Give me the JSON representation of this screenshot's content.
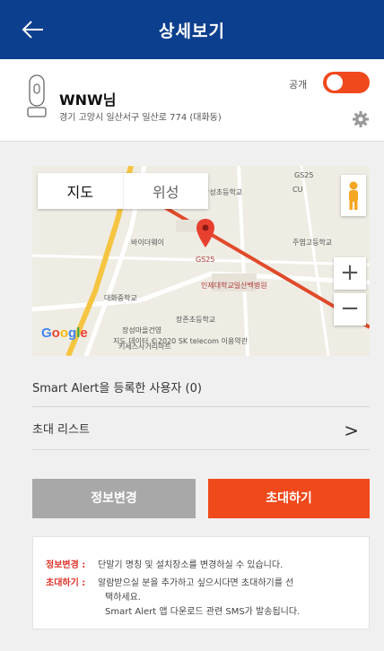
{
  "header": {
    "title": "상세보기"
  },
  "device": {
    "name": "WNW님",
    "address": "경기 고양시 일산서구 일산로 774 (대화동)",
    "public_label": "공개"
  },
  "map": {
    "tab_map": "지도",
    "tab_satellite": "위성",
    "zoom_in": "+",
    "zoom_out": "−",
    "logo": "Google",
    "footer": "지도 데이터 ©2020 SK telecom   이용약관",
    "labels": {
      "school1": "장성초등학교",
      "cu": "CU",
      "gs_top": "GS25",
      "school2": "주엽고등학교",
      "bidi": "바이더웨이",
      "gs": "GS25",
      "hospital": "인제대학교일산백병원",
      "daehwa": "대화중학교",
      "jangjeon": "장존초등학교",
      "apt": "장성마을건영",
      "apt2": "키세스사거리마트"
    }
  },
  "rows": {
    "alert_users": "Smart Alert을 등록한 사용자 (0)",
    "invite_list": "초대 리스트",
    "chevron": ">"
  },
  "buttons": {
    "edit": "정보변경",
    "invite": "초대하기"
  },
  "info": {
    "edit_key": "정보변경 :",
    "edit_text": "단말기 명칭 및 설치장소를 변경하실 수 있습니다.",
    "invite_key": "초대하기 :",
    "invite_text1": "알람받으실 분을 추가하고 싶으시다면 초대하기를 선",
    "invite_text2": "택하세요.",
    "invite_text3": "Smart Alert 앱 다운로드 관련 SMS가 발송됩니다."
  },
  "colors": {
    "header": "#0d3f8f",
    "accent": "#f0491c",
    "disabled": "#a8a8a8"
  }
}
